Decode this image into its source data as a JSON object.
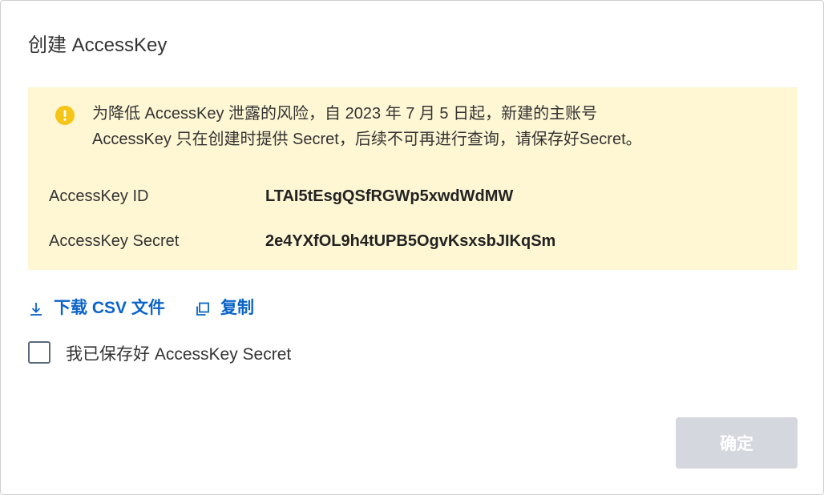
{
  "dialog": {
    "title": "创建 AccessKey"
  },
  "notice": {
    "icon": "warning-icon",
    "icon_color": "#f5c518",
    "line1": "为降低 AccessKey 泄露的风险，自 2023 年 7 月 5 日起，新建的主账号",
    "line2": "AccessKey 只在创建时提供 Secret，后续不可再进行查询，请保存好Secret。",
    "background": "#fff7d4"
  },
  "credentials": {
    "id_label": "AccessKey ID",
    "id_value": "LTAI5tEsgQSfRGWp5xwdWdMW",
    "secret_label": "AccessKey Secret",
    "secret_value": "2e4YXfOL9h4tUPB5OgvKsxsbJIKqSm"
  },
  "actions": {
    "download_icon": "download-icon",
    "download_label": "下载 CSV 文件",
    "copy_icon": "copy-icon",
    "copy_label": "复制",
    "link_color": "#0a63c9"
  },
  "confirm": {
    "checkbox_checked": false,
    "label": "我已保存好 AccessKey Secret"
  },
  "footer": {
    "ok_label": "确定",
    "ok_disabled": true,
    "ok_color": "#d4d7dd"
  }
}
